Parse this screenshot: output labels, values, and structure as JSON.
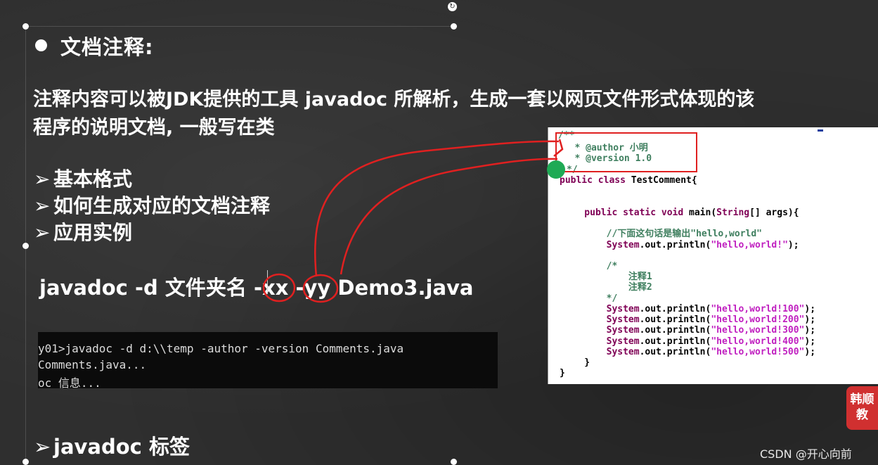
{
  "slide": {
    "title": "文档注释:",
    "paragraph_lines": [
      "注释内容可以被JDK提供的工具 javadoc 所解析，生成一套以网页文件形式体现的该",
      "程序的说明文档, 一般写在类"
    ],
    "list_items": [
      "基本格式",
      "如何生成对应的文档注释",
      "应用实例"
    ],
    "list_arrow": "➢",
    "command_text": "javadoc -d 文件夹名 -xx -yy Demo3.java",
    "tags_title": "javadoc 标签"
  },
  "terminal": {
    "lines": [
      "y01>javadoc -d d:\\\\temp -author -version Comments.java",
      "Comments.java...",
      "oc 信息..."
    ]
  },
  "code": {
    "l1": "/**",
    "l2a": "   * ",
    "l2b": "@author 小明",
    "l3a": "   * ",
    "l3b": "@version 1.0",
    "l4": "*/",
    "l5a": "public class",
    "l5b": " TestComment{",
    "l6a": "    public static void",
    "l6b": " main(",
    "l6c": "String",
    "l6d": "[] args){",
    "l7": "        //下面这句话是输出\"hello,world\"",
    "l8a": "        System",
    "l8b": ".out.println(",
    "l8c": "\"hello,world!\"",
    "l8d": ");",
    "l9": "        /*",
    "l10": "            注释1",
    "l11": "            注释2",
    "l12": "        */",
    "l13a": "        System",
    "l13b": ".out.println(",
    "l13c": "\"hello,world!100\"",
    "l13d": ");",
    "l14a": "        System",
    "l14b": ".out.println(",
    "l14c": "\"hello,world!200\"",
    "l14d": ");",
    "l15a": "        System",
    "l15b": ".out.println(",
    "l15c": "\"hello,world!300\"",
    "l15d": ");",
    "l16a": "        System",
    "l16b": ".out.println(",
    "l16c": "\"hello,world!400\"",
    "l16d": ");",
    "l17a": "        System",
    "l17b": ".out.println(",
    "l17c": "\"hello,world!500\"",
    "l17d": ");",
    "l18": "    }",
    "l19": "}"
  },
  "badge": {
    "line1": "韩顺",
    "line2": "教"
  },
  "watermark": "CSDN @开心向前",
  "colors": {
    "background": "#2f2f2f",
    "annotation_red": "#e02020",
    "comment_green": "#3f7f5f",
    "keyword_purple": "#7f0055",
    "string_blue": "#2a00ff",
    "badge_red": "#d03030"
  }
}
